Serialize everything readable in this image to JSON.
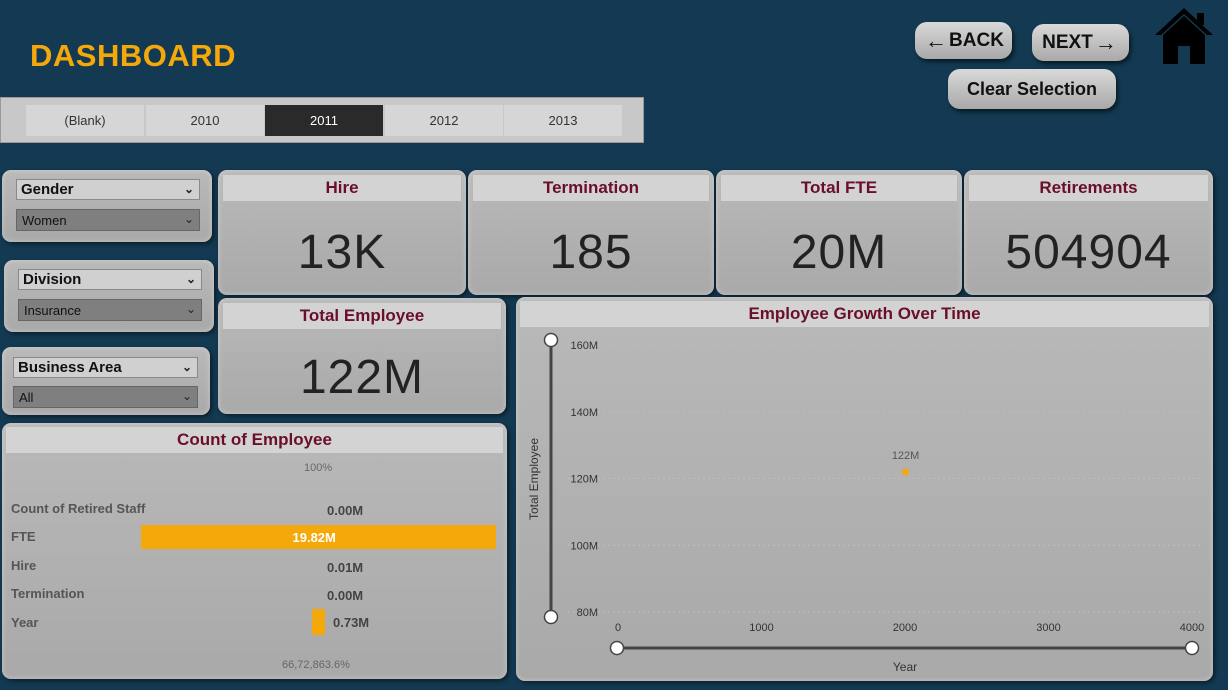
{
  "header": {
    "title": "DASHBOARD",
    "back_label": "BACK",
    "next_label": "NEXT",
    "clear_label": "Clear Selection",
    "home_icon": "home-icon"
  },
  "years": {
    "items": [
      "(Blank)",
      "2010",
      "2011",
      "2012",
      "2013"
    ],
    "selected": "2011"
  },
  "slicers": {
    "gender": {
      "label": "Gender",
      "value": "Women"
    },
    "division": {
      "label": "Division",
      "value": "Insurance"
    },
    "business_area": {
      "label": "Business Area",
      "value": "All"
    }
  },
  "kpis": {
    "hire": {
      "label": "Hire",
      "value": "13K"
    },
    "termination": {
      "label": "Termination",
      "value": "185"
    },
    "total_fte": {
      "label": "Total FTE",
      "value": "20M"
    },
    "retirements": {
      "label": "Retirements",
      "value": "504904"
    },
    "total_employee": {
      "label": "Total Employee",
      "value": "122M"
    }
  },
  "count_panel": {
    "title": "Count of Employee",
    "top_pct": "100%",
    "bottom_pct": "66,72,863.6%"
  },
  "growth_panel": {
    "title": "Employee Growth Over Time"
  },
  "colors": {
    "background": "#133a52",
    "accent": "#f5a80a",
    "header_text": "#6a0f2a"
  },
  "chart_data": [
    {
      "type": "bar",
      "orientation": "horizontal",
      "title": "Count of Employee",
      "categories": [
        "Count of Retired Staff",
        "FTE",
        "Hire",
        "Termination",
        "Year"
      ],
      "values": [
        0.0,
        19.82,
        0.01,
        0.0,
        0.73
      ],
      "value_labels": [
        "0.00M",
        "19.82M",
        "0.01M",
        "0.00M",
        "0.73M"
      ],
      "unit": "M"
    },
    {
      "type": "scatter",
      "title": "Employee Growth Over Time",
      "xlabel": "Year",
      "ylabel": "Total Employee",
      "xlim": [
        0,
        4000
      ],
      "ylim": [
        80,
        160
      ],
      "xticks": [
        "0",
        "1000",
        "2000",
        "3000",
        "4000"
      ],
      "yticks": [
        "160M",
        "140M",
        "120M",
        "100M",
        "80M"
      ],
      "points": [
        {
          "x": 2011,
          "y": 122,
          "label": "122M"
        }
      ]
    }
  ]
}
